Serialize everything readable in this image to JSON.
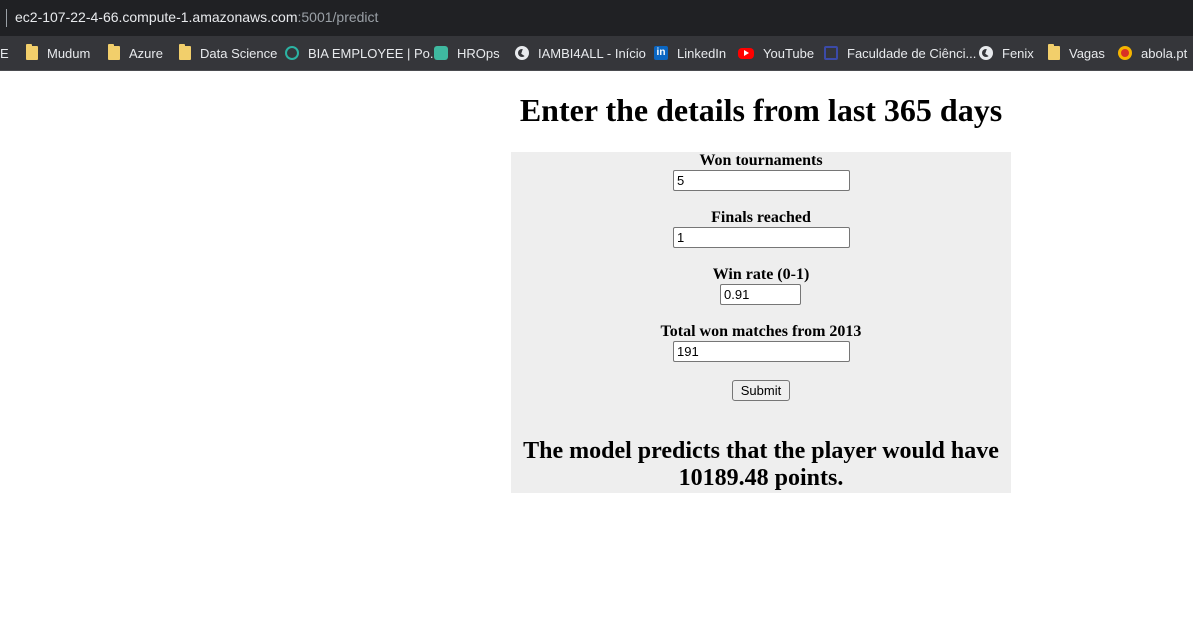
{
  "browser": {
    "url_host": "ec2-107-22-4-66.compute-1.amazonaws.com",
    "url_path": ":5001/predict"
  },
  "bookmarks": [
    {
      "label": "E",
      "icon": "text-fragment"
    },
    {
      "label": "Mudum",
      "icon": "folder-icon"
    },
    {
      "label": "Azure",
      "icon": "folder-icon"
    },
    {
      "label": "Data Science",
      "icon": "folder-icon"
    },
    {
      "label": "BIA EMPLOYEE | Po...",
      "icon": "bia-icon"
    },
    {
      "label": "HROps",
      "icon": "hrops-icon"
    },
    {
      "label": "IAMBI4ALL - Início",
      "icon": "globe-icon"
    },
    {
      "label": "LinkedIn",
      "icon": "linkedin-icon"
    },
    {
      "label": "YouTube",
      "icon": "youtube-icon"
    },
    {
      "label": "Faculdade de Ciênci...",
      "icon": "faculdade-icon"
    },
    {
      "label": "Fenix",
      "icon": "globe-icon"
    },
    {
      "label": "Vagas",
      "icon": "folder-icon"
    },
    {
      "label": "abola.pt",
      "icon": "abola-icon"
    }
  ],
  "page": {
    "heading": "Enter the details from last 365 days",
    "fields": [
      {
        "label": "Won tournaments",
        "value": "5"
      },
      {
        "label": "Finals reached",
        "value": "1"
      },
      {
        "label": "Win rate (0-1)",
        "value": "0.91"
      },
      {
        "label": "Total won matches from 2013",
        "value": "191"
      }
    ],
    "submit_label": "Submit",
    "result": "The model predicts that the player would have 10189.48 points."
  },
  "colors": {
    "panel_background": "#eeeeee",
    "chrome_dark": "#202124",
    "bookmarks_bar": "#35363a"
  }
}
